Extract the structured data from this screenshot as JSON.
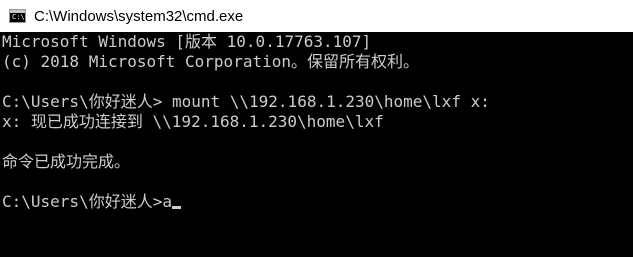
{
  "window": {
    "title": "C:\\Windows\\system32\\cmd.exe",
    "icon": "cmd-icon"
  },
  "console": {
    "lines": [
      "Microsoft Windows [版本 10.0.17763.107]",
      "(c) 2018 Microsoft Corporation。保留所有权利。",
      "",
      "C:\\Users\\你好迷人> mount \\\\192.168.1.230\\home\\lxf x:",
      "x: 现已成功连接到 \\\\192.168.1.230\\home\\lxf",
      "",
      "命令已成功完成。",
      "",
      "C:\\Users\\你好迷人>a"
    ],
    "colors": {
      "background": "#000000",
      "text": "#cccccc"
    }
  }
}
